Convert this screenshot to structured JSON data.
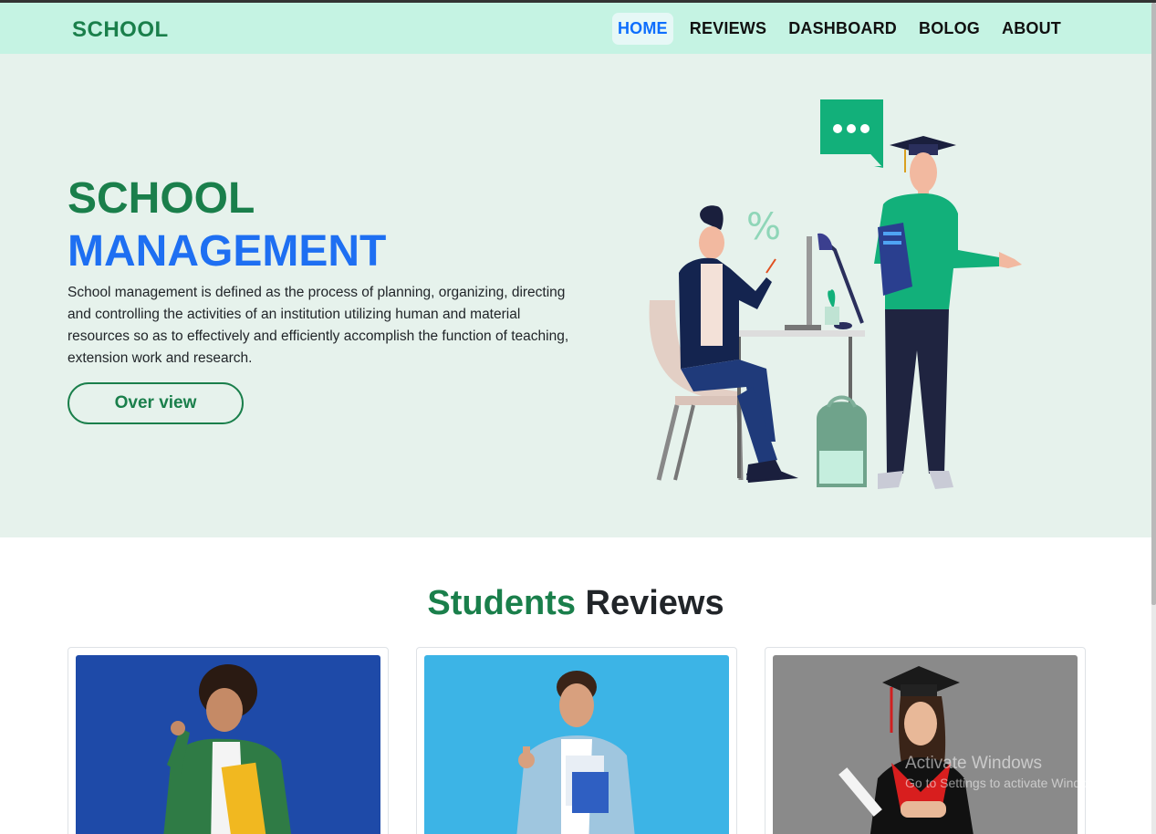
{
  "brand": "SCHOOL",
  "nav": {
    "items": [
      {
        "label": "HOME",
        "active": true
      },
      {
        "label": "REVIEWS",
        "active": false
      },
      {
        "label": "DASHBOARD",
        "active": false
      },
      {
        "label": "BOLOG",
        "active": false
      },
      {
        "label": "ABOUT",
        "active": false
      }
    ]
  },
  "hero": {
    "title_line1": "SCHOOL",
    "title_line2": "MANAGEMENT",
    "description": "School management is defined as the process of planning, organizing, directing and controlling the activities of an institution utilizing human and material resources so as to effectively and efficiently accomplish the function of teaching, extension work and research.",
    "button_label": "Over view"
  },
  "reviews": {
    "title_green": "Students",
    "title_dark": "Reviews",
    "cards": [
      {
        "photo": "student-curly-hair-blue-background"
      },
      {
        "photo": "student-thumbs-up-light-blue-background"
      },
      {
        "photo": "graduate-girl-gray-background"
      }
    ]
  },
  "watermark": {
    "line1": "Activate Windows",
    "line2": "Go to Settings to activate Windows."
  },
  "colors": {
    "navbar_bg": "#c5f3e3",
    "hero_bg": "#e6f2ec",
    "brand_green": "#1a7f4b",
    "accent_blue": "#1e6ff2",
    "active_link": "#0d6efd"
  }
}
